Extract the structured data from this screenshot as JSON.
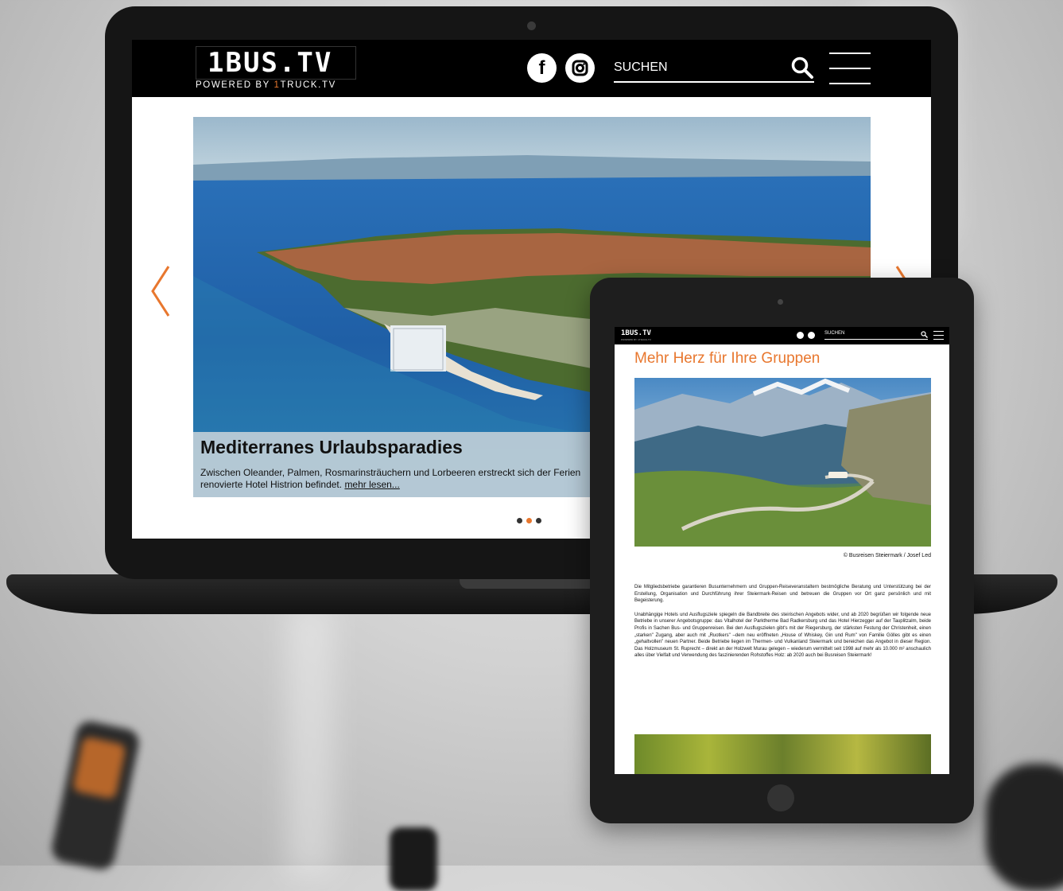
{
  "site": {
    "logo_main": "1BUS.TV",
    "logo_sub_prefix": "POWERED BY ",
    "logo_sub_accent": "1",
    "logo_sub_suffix": "TRUCK.TV",
    "accent_color": "#e8772e",
    "nav_bg": "#000000"
  },
  "nav": {
    "facebook_icon": "facebook-icon",
    "instagram_icon": "instagram-icon",
    "search_placeholder": "SUCHEN",
    "search_icon": "search-icon",
    "menu_icon": "hamburger-menu-icon"
  },
  "slider": {
    "title": "Mediterranes Urlaubsparadies",
    "text_line1": "Zwischen Oleander, Palmen, Rosmarinsträuchern und Lorbeeren erstreckt sich der Ferien",
    "text_line2": "renovierte Hotel Histrion befindet. ",
    "read_more": "mehr lesen...",
    "prev_icon": "chevron-left-icon",
    "next_icon": "chevron-right-icon",
    "dots_total": 3,
    "active_dot": 2
  },
  "tablet": {
    "logo": "1BUS.TV",
    "logo_sub": "POWERED BY 1TRUCK.TV",
    "search_placeholder": "SUCHEN",
    "title": "Mehr Herz für Ihre Gruppen",
    "photo_credit": "© Busreisen Steiermark / Josef Led",
    "paragraph1": "Die Mitgliedsbetriebe garantieren Busunternehmern und Gruppen-Reiseveranstaltern bestmögliche Beratung und Unterstützung bei der Erstellung, Organisation und Durchführung ihrer Steiermark-Reisen und betreuen die Gruppen vor Ort ganz persönlich und mit Begeisterung.",
    "paragraph2": "Unabhängige Hotels und Ausflugsziele spiegeln die Bandbreite des steirischen Angebots wider, und ab 2020 begrüßen wir folgende neue Betriebe in unserer Angebotsgruppe: das Vitalhotel der Parktherme Bad Radkersburg und das Hotel Hierzegger auf der Tauplitzalm, beide Profis in Sachen Bus- und Gruppenreisen. Bei den Ausflugszielen gibt's mit der Riegersburg, der stärksten Festung der Christenheit, einen „starken\" Zugang, aber auch mit „Ruotkers\" –dem neu eröffneten „House of Whiskey, Gin und Rum\" von Familie Gölles gibt es einen „gehaltvollen\" neuen Partner. Beide Betriebe liegen im Thermen- und Vulkanland Steiermark und bereichen das Angebot in dieser Region. Das Holzmuseum St. Ruprecht – direkt an der Holzwelt Murau gelegen – wiederum vermittelt seit 1998 auf mehr als 10.000 m² anschaulich alles über Vielfalt und Verwendung des faszinierenden Rohstoffes Holz: ab 2020 auch bei Busreisen Steiermark!"
  }
}
